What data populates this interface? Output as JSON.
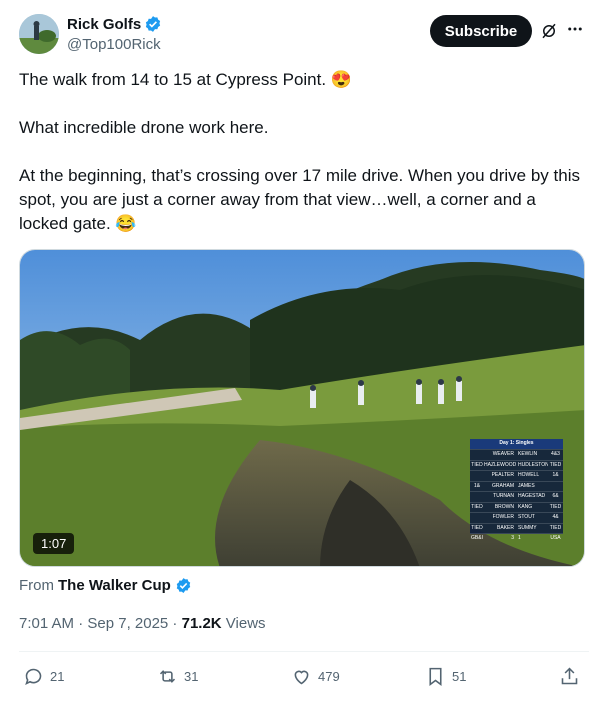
{
  "account": {
    "name": "Rick Golfs",
    "handle": "@Top100Rick"
  },
  "header": {
    "subscribe_label": "Subscribe"
  },
  "tweet": {
    "paragraphs": [
      "The walk from 14 to 15 at Cypress Point. 😍",
      "What incredible drone work here.",
      "At the beginning, that’s crossing over 17 mile drive. When you drive by this spot, you are just a corner away from that view…well, a corner and a locked gate. 😂"
    ]
  },
  "media": {
    "duration": "1:07",
    "scoreboard_title": "Day 1: Singles",
    "scoreboard": [
      {
        "left": "",
        "lname": "WEAVER",
        "rname": "KEWLIN",
        "right": "4&3",
        "lc": "#1e4aa8",
        "rc": "#c8283c"
      },
      {
        "left": "TIED",
        "lname": "HAZLEWOOD",
        "rname": "HUDLESTON",
        "right": "TIED",
        "lc": "#1e4aa8",
        "rc": "#c8283c"
      },
      {
        "left": "",
        "lname": "PEALTER",
        "rname": "HOWELL",
        "right": "1&",
        "lc": "#1e4aa8",
        "rc": "#c8283c"
      },
      {
        "left": "1&",
        "lname": "GRAHAM",
        "rname": "JAMES",
        "right": "",
        "lc": "#1e4aa8",
        "rc": "#c8283c"
      },
      {
        "left": "",
        "lname": "TURNAN",
        "rname": "HAGESTAD",
        "right": "6&",
        "lc": "#1e4aa8",
        "rc": "#c8283c"
      },
      {
        "left": "TIED",
        "lname": "BROWN",
        "rname": "KANG",
        "right": "TIED",
        "lc": "#1e4aa8",
        "rc": "#c8283c"
      },
      {
        "left": "",
        "lname": "FOWLER",
        "rname": "STOUT",
        "right": "4&",
        "lc": "#1e4aa8",
        "rc": "#c8283c"
      },
      {
        "left": "TIED",
        "lname": "BAKER",
        "rname": "SUMMY",
        "right": "TIED",
        "lc": "#1e4aa8",
        "rc": "#c8283c"
      },
      {
        "left": "GB&I",
        "lname": "3",
        "rname": "1",
        "right": "USA",
        "lc": "#1e4aa8",
        "rc": "#c8283c"
      }
    ]
  },
  "source": {
    "prefix": "From",
    "name": "The Walker Cup"
  },
  "meta": {
    "time": "7:01 AM · Sep 7, 2025 · ",
    "views_count": "71.2K",
    "views_label": " Views"
  },
  "actions": {
    "replies": "21",
    "reposts": "31",
    "likes": "479",
    "bookmarks": "51"
  },
  "colors": {
    "verified": "#1d9bf0",
    "text": "#0f1419",
    "muted": "#536471"
  }
}
